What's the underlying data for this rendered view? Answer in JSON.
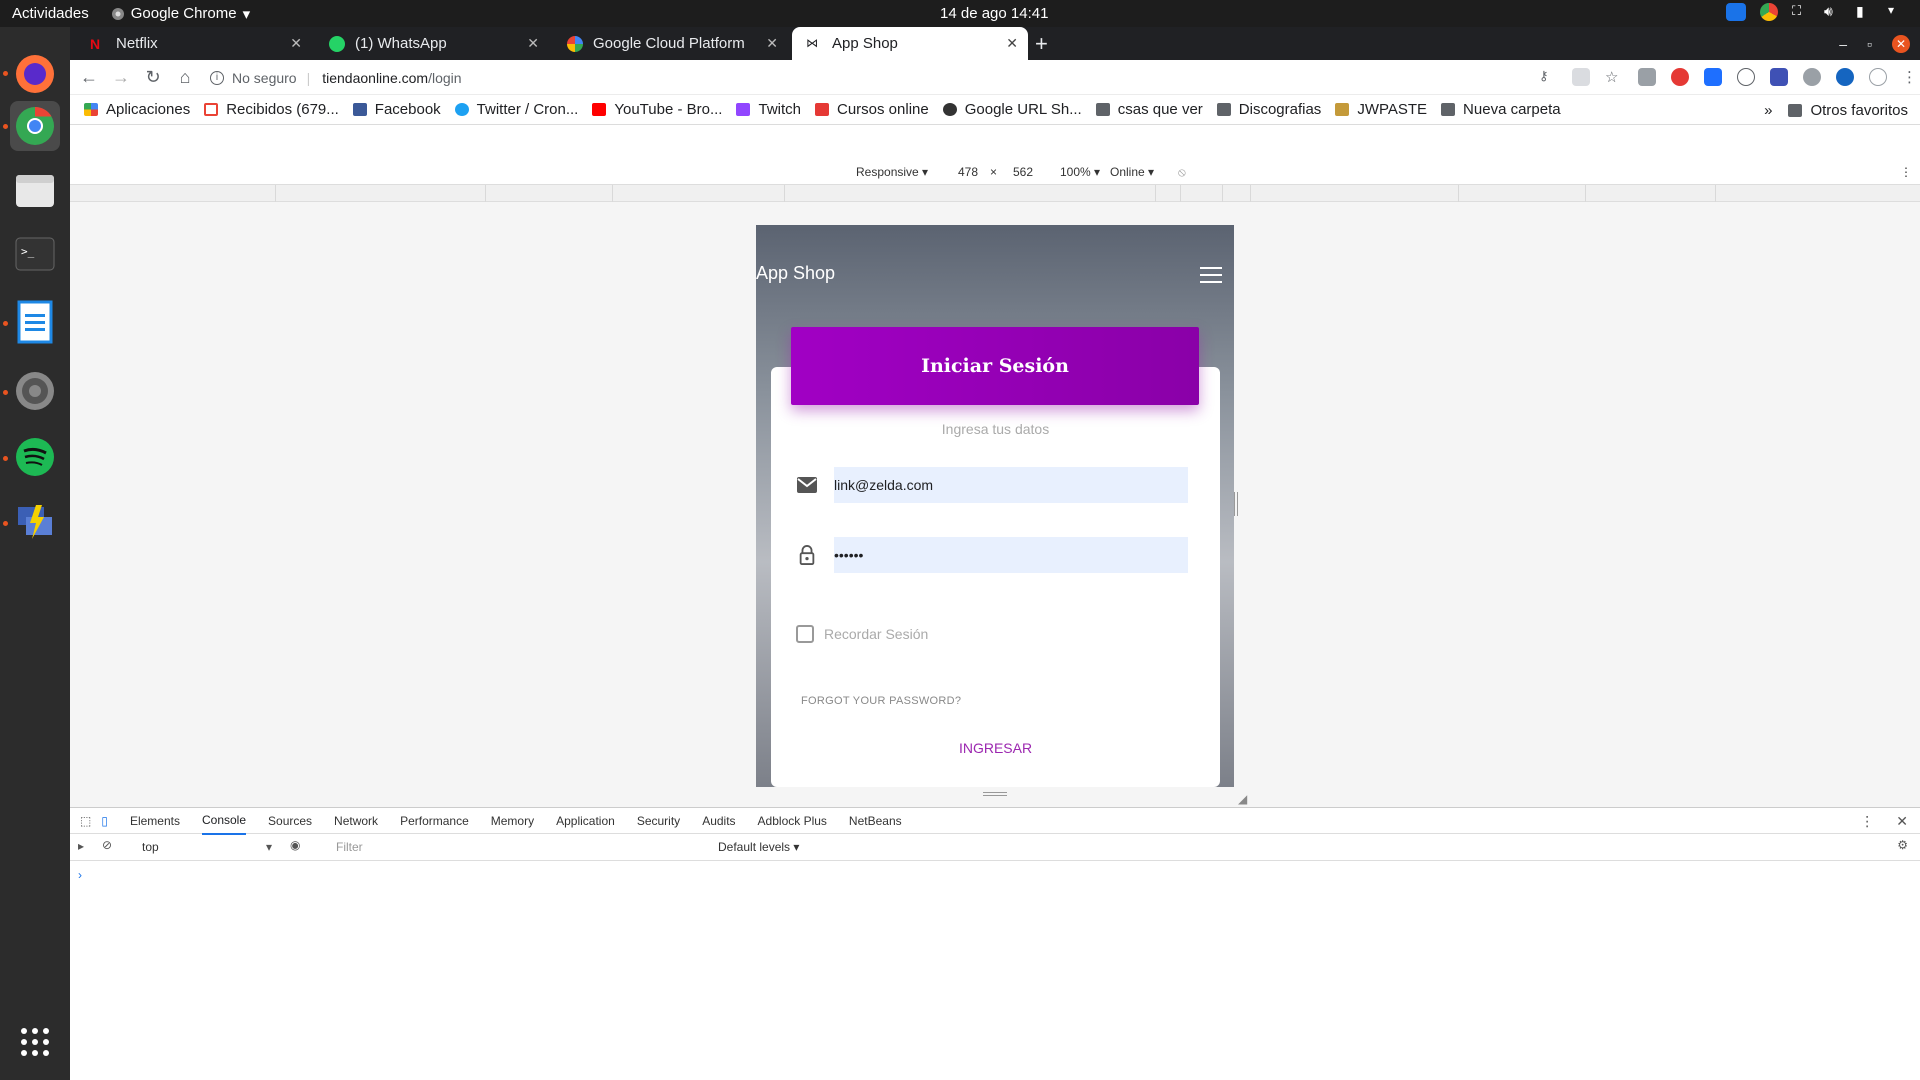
{
  "topbar": {
    "activities": "Actividades",
    "app": "Google Chrome",
    "clock": "14 de ago  14:41"
  },
  "tabs": [
    {
      "title": "Netflix"
    },
    {
      "title": "(1) WhatsApp"
    },
    {
      "title": "Google Cloud Platform"
    },
    {
      "title": "App Shop"
    }
  ],
  "omnibox": {
    "security": "No seguro",
    "host": "tiendaonline.com",
    "path": "/login"
  },
  "bookmarks": [
    "Aplicaciones",
    "Recibidos (679...",
    "Facebook",
    "Twitter / Cron...",
    "YouTube - Bro...",
    "Twitch",
    "Cursos online",
    "Google URL Sh...",
    "csas que ver",
    "Discografias",
    "JWPASTE",
    "Nueva carpeta"
  ],
  "bookmarks_other": "Otros favoritos",
  "bookmarks_more": "»",
  "device_toolbar": {
    "mode": "Responsive ▾",
    "width": "478",
    "times": "×",
    "height": "562",
    "zoom": "100% ▾",
    "network": "Online ▾"
  },
  "page": {
    "brand": "App Shop",
    "header": "Iniciar Sesión",
    "subtitle": "Ingresa tus datos",
    "email_value": "link@zelda.com",
    "password_value": "••••••",
    "remember_label": "Recordar Sesión",
    "forgot_label": "FORGOT YOUR PASSWORD?",
    "submit_label": "INGRESAR"
  },
  "devtools": {
    "tabs": [
      "Elements",
      "Console",
      "Sources",
      "Network",
      "Performance",
      "Memory",
      "Application",
      "Security",
      "Audits",
      "Adblock Plus",
      "NetBeans"
    ],
    "context": "top",
    "filter_placeholder": "Filter",
    "levels": "Default levels ▾",
    "prompt": "›"
  },
  "colors": {
    "accent": "#9c27b0",
    "header_gradient_start": "#a100c4",
    "header_gradient_end": "#8a00a8",
    "autofill": "#e8f0fe"
  }
}
